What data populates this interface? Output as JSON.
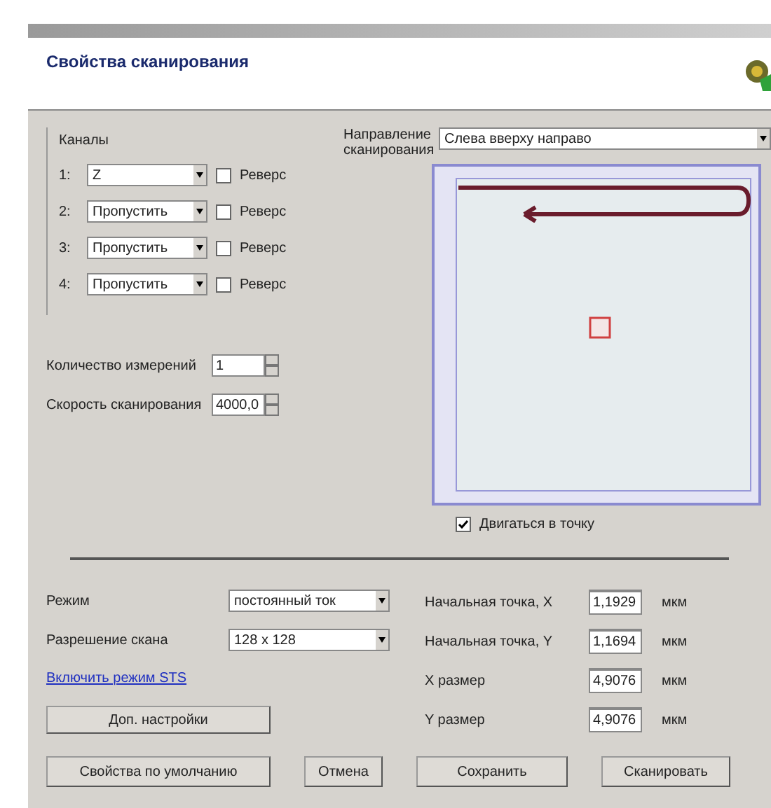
{
  "header": {
    "title": "Свойства сканирования"
  },
  "channels": {
    "title": "Каналы",
    "items": [
      {
        "number": "1:",
        "value": "Z",
        "reverse_label": "Реверс",
        "reverse": false
      },
      {
        "number": "2:",
        "value": "Пропустить",
        "reverse_label": "Реверс",
        "reverse": false
      },
      {
        "number": "3:",
        "value": "Пропустить",
        "reverse_label": "Реверс",
        "reverse": false
      },
      {
        "number": "4:",
        "value": "Пропустить",
        "reverse_label": "Реверс",
        "reverse": false
      }
    ]
  },
  "counts": [
    {
      "label": "Количество измерений",
      "value": "1"
    },
    {
      "label": "Скорость сканирования",
      "value": "4000,0"
    }
  ],
  "direction": {
    "label": "Направление сканирования",
    "value": "Слева вверху направо"
  },
  "move_to_point": {
    "label": "Двигаться в точку",
    "checked": true
  },
  "mode": {
    "label": "Режим",
    "value": "постоянный ток"
  },
  "resolution": {
    "label": "Разрешение скана",
    "value": "128 x 128"
  },
  "link": "Включить режим STS",
  "extra_button": "Доп. настройки",
  "coords": [
    {
      "label": "Начальная точка, X",
      "value": "1,1929",
      "unit": "мкм"
    },
    {
      "label": "Начальная точка, Y",
      "value": "1,1694",
      "unit": "мкм"
    },
    {
      "label": "X размер",
      "value": "4,9076",
      "unit": "мкм"
    },
    {
      "label": "Y размер",
      "value": "4,9076",
      "unit": "мкм"
    }
  ],
  "buttons": [
    "Свойства по умолчанию",
    "Отмена",
    "Сохранить",
    "Сканировать"
  ]
}
